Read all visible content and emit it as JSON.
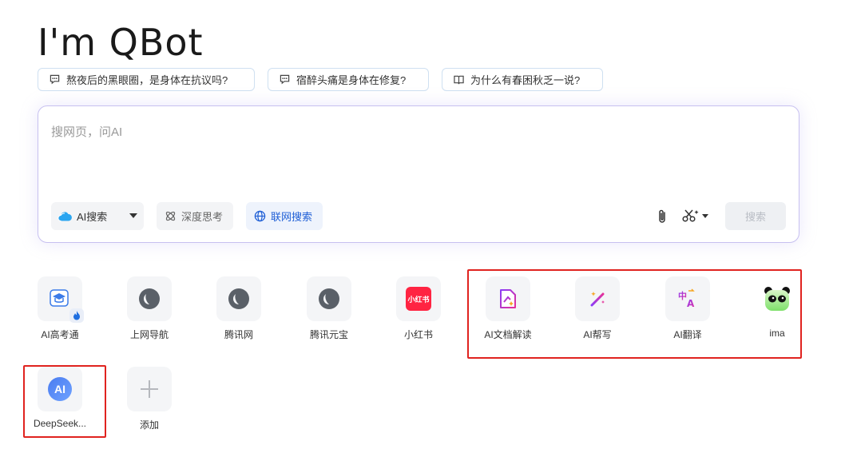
{
  "header": {
    "title": "I'm QBot"
  },
  "suggestions": [
    {
      "icon": "chat-bubble-icon",
      "text": "熬夜后的黑眼圈，是身体在抗议吗?"
    },
    {
      "icon": "chat-bubble-icon",
      "text": "宿醉头痛是身体在修复?"
    },
    {
      "icon": "book-icon",
      "text": "为什么有春困秋乏一说?"
    }
  ],
  "search": {
    "placeholder": "搜网页，问AI",
    "mode_label": "AI搜索",
    "deep_think_label": "深度思考",
    "web_search_label": "联网搜索",
    "submit_label": "搜索"
  },
  "apps": [
    {
      "label": "AI高考通",
      "icon": "graduation-cap-icon"
    },
    {
      "label": "上网导航",
      "icon": "globe-icon"
    },
    {
      "label": "腾讯网",
      "icon": "globe-icon"
    },
    {
      "label": "腾讯元宝",
      "icon": "globe-icon"
    },
    {
      "label": "小红书",
      "icon": "xiaohongshu-logo-icon",
      "logo_text": "小红书"
    },
    {
      "label": "AI文档解读",
      "icon": "document-ai-icon"
    },
    {
      "label": "AI帮写",
      "icon": "magic-wand-icon"
    },
    {
      "label": "AI翻译",
      "icon": "translate-icon"
    },
    {
      "label": "ima",
      "icon": "panda-icon"
    },
    {
      "label": "DeepSeek...",
      "icon": "ai-badge-icon",
      "logo_text": "AI"
    },
    {
      "label": "添加",
      "icon": "plus-icon"
    }
  ],
  "colors": {
    "accent_blue": "#1f5fd6",
    "highlight_red": "#e0231f",
    "xhs_red": "#ff2442"
  }
}
